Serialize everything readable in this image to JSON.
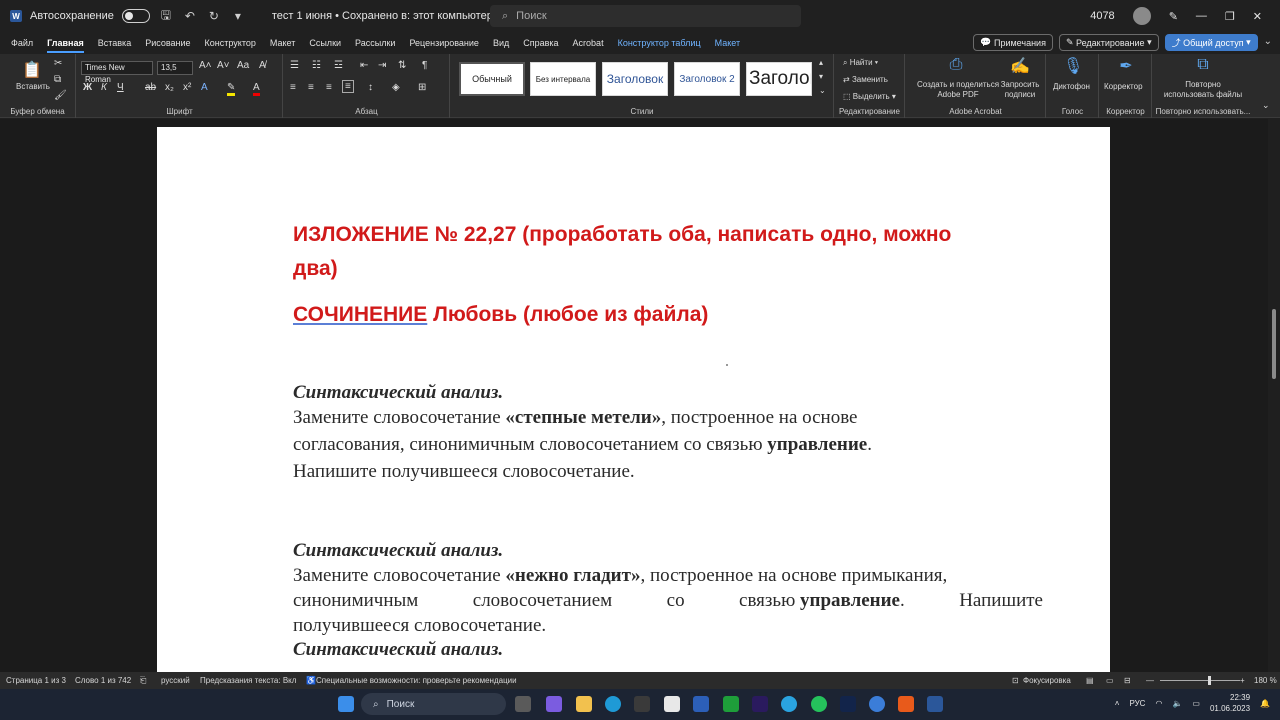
{
  "titlebar": {
    "autosave_label": "Автосохранение",
    "doc_title": "тест 1 июня • Сохранено в: этот компьютер",
    "search_placeholder": "Поиск",
    "user_number": "4078"
  },
  "tabs": [
    "Файл",
    "Главная",
    "Вставка",
    "Рисование",
    "Конструктор",
    "Макет",
    "Ссылки",
    "Рассылки",
    "Рецензирование",
    "Вид",
    "Справка",
    "Acrobat"
  ],
  "context_tabs": [
    "Конструктор таблиц",
    "Макет"
  ],
  "right_buttons": {
    "comments": "Примечания",
    "editing": "Редактирование",
    "share": "Общий доступ"
  },
  "ribbon": {
    "clipboard": {
      "paste": "Вставить",
      "label": "Буфер обмена"
    },
    "font": {
      "name": "Times New Roman",
      "size": "13,5",
      "label": "Шрифт"
    },
    "paragraph": {
      "label": "Абзац"
    },
    "styles": {
      "items": [
        "Обычный",
        "Без интервала",
        "Заголовок",
        "Заголовок 2",
        "Заголовок"
      ],
      "label": "Стили"
    },
    "editing": {
      "find": "Найти",
      "replace": "Заменить",
      "select": "Выделить",
      "label": "Редактирование"
    },
    "acrobat": {
      "create": "Создать и поделиться Adobe PDF",
      "request": "Запросить подписи",
      "label": "Adobe Acrobat"
    },
    "voice": {
      "dictate": "Диктофон",
      "label": "Голос"
    },
    "editor": {
      "btn": "Корректор",
      "label": "Корректор"
    },
    "reuse": {
      "btn": "Повторно использовать файлы",
      "label": "Повторно использовать..."
    }
  },
  "document": {
    "heading1_line1": "ИЗЛОЖЕНИЕ № 22,27 (проработать оба, написать одно, можно",
    "heading1_line2": "два)",
    "heading2_underlined": "СОЧИНЕНИЕ",
    "heading2_rest": " Любовь (любое из файла)",
    "block1": {
      "title": "Синтаксический анализ.",
      "l1_pre": "Замените словосочетание ",
      "l1_bold": "«степные метели»",
      "l1_post": ", построенное на основе",
      "l2_pre": "согласования, синонимичным словосочетанием со связью ",
      "l2_bold": "управление",
      "l2_post": ".",
      "l3": "Напишите получившееся словосочетание."
    },
    "block2": {
      "title": "Синтаксический анализ.",
      "l1_pre": "Замените словосочетание ",
      "l1_bold": "«нежно гладит»",
      "l1_post": ", построенное на основе примыкания,",
      "l2_a": "синонимичным",
      "l2_b": "словосочетанием",
      "l2_c": "со",
      "l2_d": "связью",
      "l2_bold": "управление",
      "l2_post": ".",
      "l2_e": "Напишите",
      "l3": "получившееся словосочетание."
    },
    "block3_title": "Синтаксический анализ."
  },
  "status": {
    "page": "Страница 1 из 3",
    "words": "Слово 1 из 742",
    "lang": "русский",
    "predict": "Предсказания текста: Вкл",
    "access": "Специальные возможности: проверьте рекомендации",
    "focus": "Фокусировка",
    "zoom": "180 %"
  },
  "taskbar": {
    "search": "Поиск",
    "lang": "РУС",
    "time": "22:39",
    "date": "01.06.2023"
  }
}
